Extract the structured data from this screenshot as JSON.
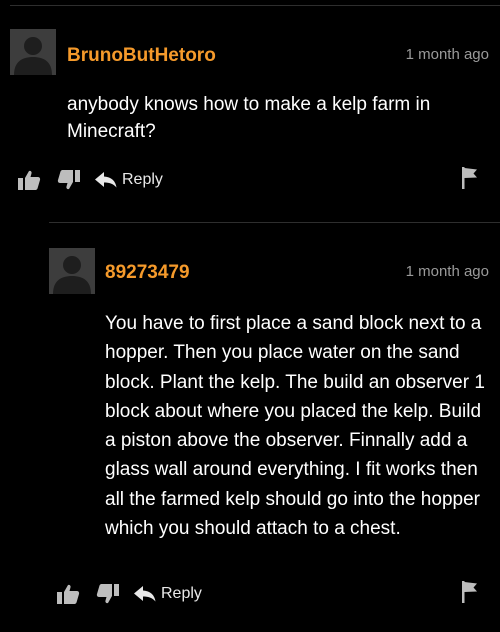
{
  "comments": [
    {
      "username": "BrunoButHetoro",
      "timestamp": "1 month ago",
      "body": "anybody knows how to make a kelp farm in Minecraft?",
      "actions": {
        "like_icon": "thumbs-up-icon",
        "dislike_icon": "thumbs-down-icon",
        "reply_icon": "reply-arrow-icon",
        "reply_label": "Reply",
        "flag_icon": "flag-icon"
      }
    },
    {
      "username": "89273479",
      "timestamp": "1 month ago",
      "body": "You have to first place a sand block next to a hopper. Then you place water on the sand block. Plant the kelp. The build an observer 1 block about where you placed the kelp. Build a piston above the observer. Finnally add a glass wall around everything. I fit works then all the farmed kelp should go into the hopper which you should attach to a chest.",
      "actions": {
        "like_icon": "thumbs-up-icon",
        "dislike_icon": "thumbs-down-icon",
        "reply_icon": "reply-arrow-icon",
        "reply_label": "Reply",
        "flag_icon": "flag-icon"
      }
    }
  ],
  "colors": {
    "background": "#000000",
    "username": "#f59a2b",
    "timestamp": "#9a9a9a",
    "body_text": "#ffffff",
    "icon": "#bdbdbd",
    "avatar_bg": "#3d3d3d",
    "avatar_silhouette": "#1e1e1e",
    "divider": "#2e2e2e"
  }
}
